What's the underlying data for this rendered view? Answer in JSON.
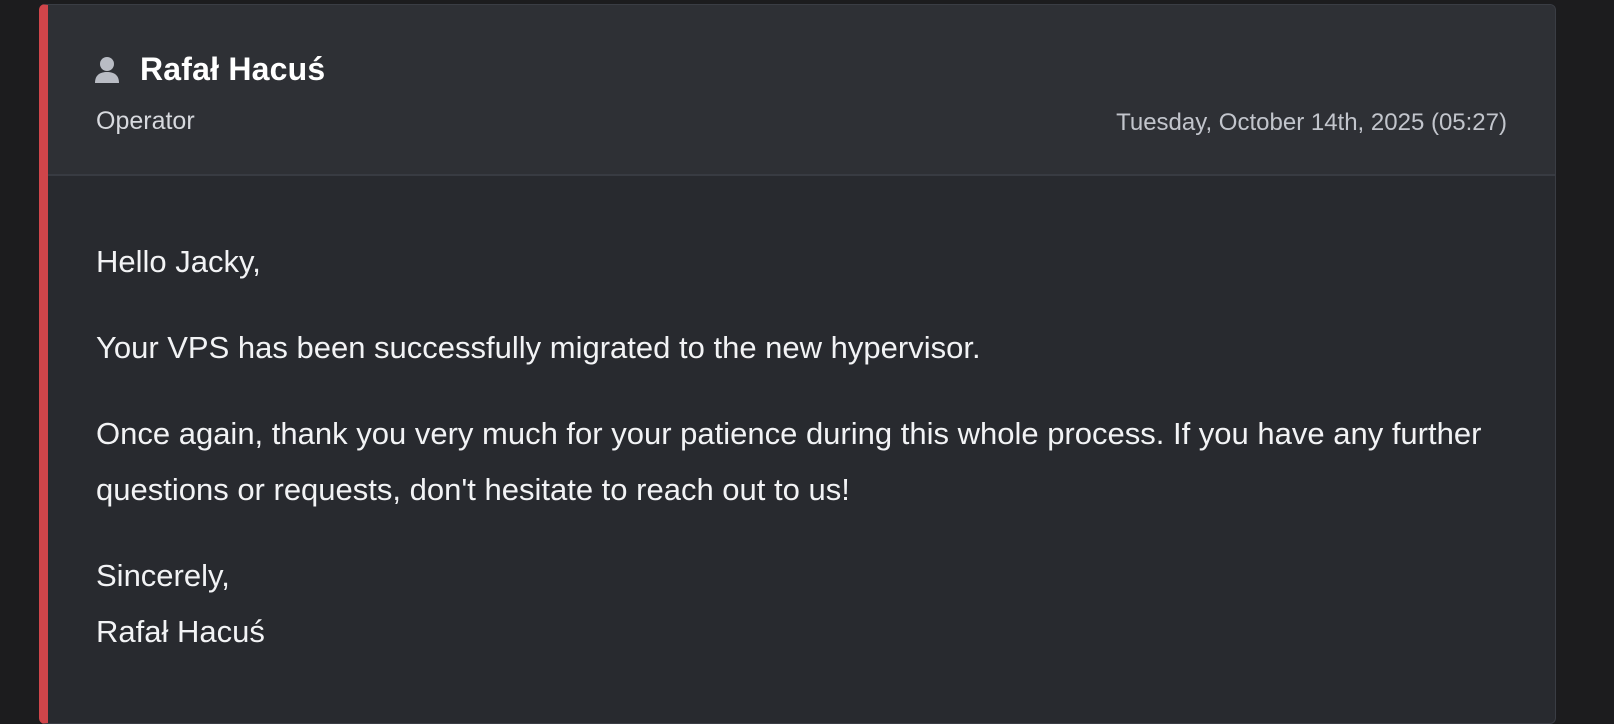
{
  "reply": {
    "author_name": "Rafał Hacuś",
    "author_role": "Operator",
    "date": "Tuesday, October 14th, 2025 (05:27)",
    "user_icon": "user-icon",
    "accent_color": "#d0454a",
    "greeting": "Hello Jacky,",
    "paragraph_1": "Your VPS has been successfully migrated to the new hypervisor.",
    "paragraph_2": "Once again, thank you very much for your patience during this whole process. If you have any further questions or requests, don't hesitate to reach out to us!",
    "closing": "Sincerely,",
    "signature": "Rafał Hacuś"
  }
}
